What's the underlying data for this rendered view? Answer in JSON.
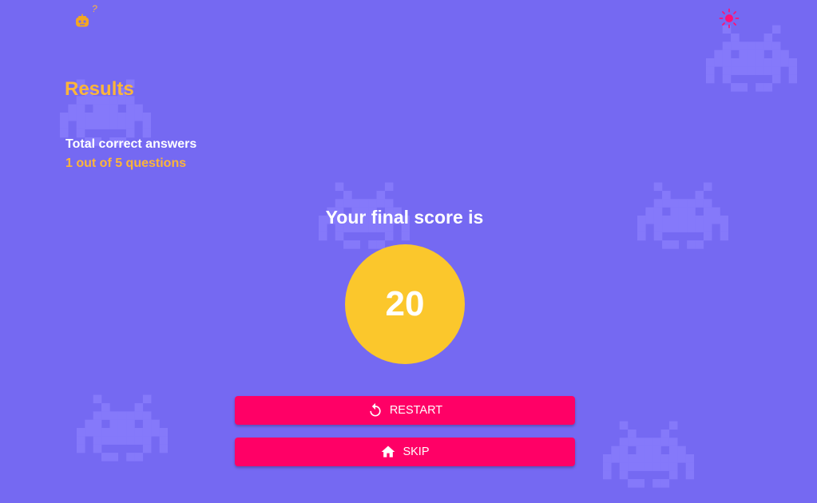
{
  "theme": {
    "background": "#7569f2",
    "invader_color": "#8579fa",
    "accent_orange": "#fdb53a",
    "score_circle": "#fbc72c",
    "button_color": "#ff0066",
    "toggle_color": "#ff1177"
  },
  "header": {
    "logo_icon": "robot-question-icon",
    "theme_toggle_icon": "sun-icon"
  },
  "results": {
    "title": "Results",
    "correct_label": "Total correct answers",
    "correct_value": "1 out of 5 questions"
  },
  "score": {
    "heading": "Your final score is",
    "value": "20"
  },
  "actions": {
    "restart_label": "RESTART",
    "restart_icon": "restart-icon",
    "skip_label": "SKIP",
    "skip_icon": "home-icon"
  }
}
